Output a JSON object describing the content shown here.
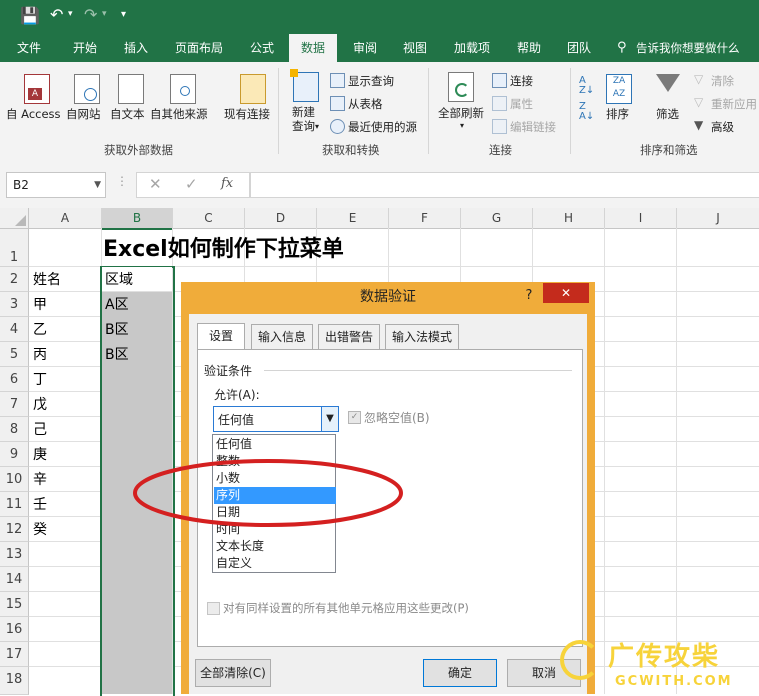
{
  "quick_access": {
    "save_icon": "save-icon",
    "undo_icon": "undo-icon",
    "redo_icon": "redo-icon",
    "more_icon": "customize-icon"
  },
  "tabs": [
    "文件",
    "开始",
    "插入",
    "页面布局",
    "公式",
    "数据",
    "审阅",
    "视图",
    "加载项",
    "帮助",
    "团队"
  ],
  "active_tab": "数据",
  "tell_me": "告诉我你想要做什么",
  "ribbon": {
    "get_external": {
      "items": [
        "自 Access",
        "自网站",
        "自文本",
        "自其他来源",
        "现有连接"
      ],
      "label": "获取外部数据"
    },
    "get_transform": {
      "new_query": "新建\n查询",
      "new_query_1": "新建",
      "new_query_2": "查询",
      "show_queries": "显示查询",
      "from_table": "从表格",
      "recent_sources": "最近使用的源",
      "label": "获取和转换"
    },
    "connections": {
      "refresh_all": "全部刷新",
      "connections": "连接",
      "properties": "属性",
      "edit_links": "编辑链接",
      "label": "连接"
    },
    "sort_filter": {
      "sort": "排序",
      "filter": "筛选",
      "clear": "清除",
      "reapply": "重新应用",
      "advanced": "高级",
      "label": "排序和筛选"
    }
  },
  "formula_bar": {
    "name_box": "B2",
    "fx": "fx",
    "value": ""
  },
  "columns": [
    "A",
    "B",
    "C",
    "D",
    "E",
    "F",
    "G",
    "H",
    "I",
    "J"
  ],
  "rows": [
    "1",
    "2",
    "3",
    "4",
    "5",
    "6",
    "7",
    "8",
    "9",
    "10",
    "11",
    "12",
    "13",
    "14",
    "15",
    "16",
    "17",
    "18"
  ],
  "sheet": {
    "title": "Excel如何制作下拉菜单",
    "col_a": [
      "姓名",
      "甲",
      "乙",
      "丙",
      "丁",
      "戊",
      "己",
      "庚",
      "辛",
      "壬",
      "癸"
    ],
    "col_b": [
      "区域",
      "A区",
      "B区",
      "B区"
    ]
  },
  "dialog": {
    "title": "数据验证",
    "help": "?",
    "close": "✕",
    "tabs": [
      "设置",
      "输入信息",
      "出错警告",
      "输入法模式"
    ],
    "active_tab": "设置",
    "section": "验证条件",
    "allow_label": "允许(A):",
    "allow_value": "任何值",
    "ignore_blank": "忽略空值(B)",
    "options": [
      "任何值",
      "整数",
      "小数",
      "序列",
      "日期",
      "时间",
      "文本长度",
      "自定义"
    ],
    "selected_option": "序列",
    "apply_all": "对有同样设置的所有其他单元格应用这些更改(P)",
    "clear_all": "全部清除(C)",
    "ok": "确定",
    "cancel": "取消"
  },
  "watermark": {
    "text": "广传攻柴",
    "url": "GCWITH.COM"
  },
  "colors": {
    "excel_green": "#217346",
    "dialog_border": "#f0ac3a",
    "close_red": "#c42b1c",
    "highlight": "#3399ff",
    "annotation": "#d42020"
  }
}
